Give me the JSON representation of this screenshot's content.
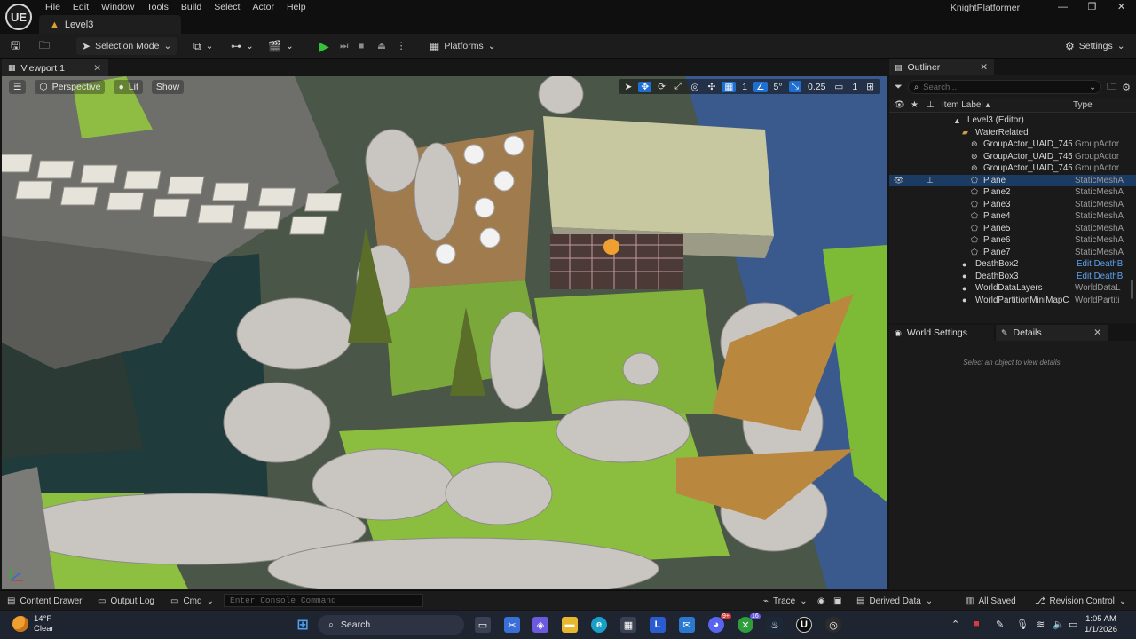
{
  "app": {
    "logo": "UE",
    "project_name": "KnightPlatformer",
    "level_tab": "Level3",
    "menu": [
      "File",
      "Edit",
      "Window",
      "Tools",
      "Build",
      "Select",
      "Actor",
      "Help"
    ],
    "window_controls": {
      "minimize": "—",
      "maximize": "❐",
      "close": "✕"
    }
  },
  "toolbar": {
    "selection_mode": "Selection Mode",
    "platforms": "Platforms",
    "settings": "Settings"
  },
  "viewport": {
    "tab_label": "Viewport 1",
    "perspective": "Perspective",
    "lit": "Lit",
    "show": "Show",
    "grid_snap": "1",
    "rotation_snap": "5°",
    "scale_snap": "0.25",
    "camera_speed": "1"
  },
  "outliner": {
    "tab_label": "Outliner",
    "search_placeholder": "Search...",
    "col_label": "Item Label ▴",
    "col_type": "Type",
    "rows": [
      {
        "name": "Level3 (Editor)",
        "type": "",
        "indent": 0,
        "icon": "level"
      },
      {
        "name": "WaterRelated",
        "type": "",
        "indent": 1,
        "icon": "folder"
      },
      {
        "name": "GroupActor_UAID_745",
        "type": "GroupActor",
        "indent": 2,
        "icon": "actor"
      },
      {
        "name": "GroupActor_UAID_745",
        "type": "GroupActor",
        "indent": 2,
        "icon": "actor"
      },
      {
        "name": "GroupActor_UAID_745",
        "type": "GroupActor",
        "indent": 2,
        "icon": "actor"
      },
      {
        "name": "Plane",
        "type": "StaticMeshA",
        "indent": 2,
        "icon": "mesh",
        "selected": true
      },
      {
        "name": "Plane2",
        "type": "StaticMeshA",
        "indent": 2,
        "icon": "mesh"
      },
      {
        "name": "Plane3",
        "type": "StaticMeshA",
        "indent": 2,
        "icon": "mesh"
      },
      {
        "name": "Plane4",
        "type": "StaticMeshA",
        "indent": 2,
        "icon": "mesh"
      },
      {
        "name": "Plane5",
        "type": "StaticMeshA",
        "indent": 2,
        "icon": "mesh"
      },
      {
        "name": "Plane6",
        "type": "StaticMeshA",
        "indent": 2,
        "icon": "mesh"
      },
      {
        "name": "Plane7",
        "type": "StaticMeshA",
        "indent": 2,
        "icon": "mesh"
      },
      {
        "name": "DeathBox2",
        "type": "Edit DeathB",
        "indent": 1,
        "icon": "box",
        "link": true
      },
      {
        "name": "DeathBox3",
        "type": "Edit DeathB",
        "indent": 1,
        "icon": "box",
        "link": true
      },
      {
        "name": "WorldDataLayers",
        "type": "WorldDataL",
        "indent": 1,
        "icon": "box"
      },
      {
        "name": "WorldPartitionMiniMapC",
        "type": "WorldPartiti",
        "indent": 1,
        "icon": "box"
      }
    ]
  },
  "details": {
    "world_settings_tab": "World Settings",
    "details_tab": "Details",
    "empty_message": "Select an object to view details."
  },
  "statusbar": {
    "content_drawer": "Content Drawer",
    "output_log": "Output Log",
    "cmd": "Cmd",
    "console_placeholder": "Enter Console Command",
    "trace": "Trace",
    "derived_data": "Derived Data",
    "all_saved": "All Saved",
    "revision_control": "Revision Control"
  },
  "taskbar": {
    "temperature": "14°F",
    "weather": "Clear",
    "search": "Search",
    "time": "1:05 AM",
    "date": "1/1/2026",
    "badge_discord": "9+",
    "badge_xbox": "16"
  },
  "colors": {
    "accent_blue": "#1f6fd1",
    "play_green": "#36c13a",
    "selected_row": "#1c3b63",
    "link_blue": "#5ea0ee"
  }
}
